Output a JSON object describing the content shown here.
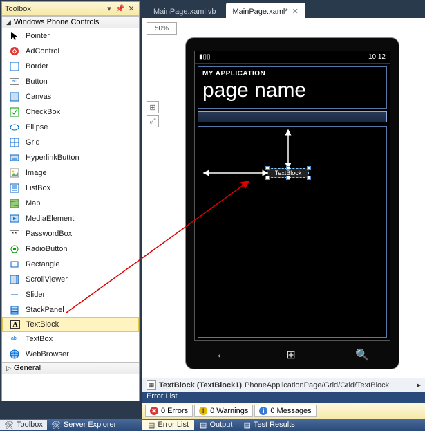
{
  "toolbox": {
    "title": "Toolbox",
    "groups": [
      {
        "label": "Windows Phone Controls",
        "expanded": true
      },
      {
        "label": "General",
        "expanded": false
      }
    ],
    "items": [
      {
        "label": "Pointer",
        "icon": "pointer-icon"
      },
      {
        "label": "AdControl",
        "icon": "adcontrol-icon"
      },
      {
        "label": "Border",
        "icon": "border-icon"
      },
      {
        "label": "Button",
        "icon": "button-icon"
      },
      {
        "label": "Canvas",
        "icon": "canvas-icon"
      },
      {
        "label": "CheckBox",
        "icon": "checkbox-icon"
      },
      {
        "label": "Ellipse",
        "icon": "ellipse-icon"
      },
      {
        "label": "Grid",
        "icon": "grid-icon"
      },
      {
        "label": "HyperlinkButton",
        "icon": "hyperlink-icon"
      },
      {
        "label": "Image",
        "icon": "image-icon"
      },
      {
        "label": "ListBox",
        "icon": "listbox-icon"
      },
      {
        "label": "Map",
        "icon": "map-icon"
      },
      {
        "label": "MediaElement",
        "icon": "media-icon"
      },
      {
        "label": "PasswordBox",
        "icon": "password-icon"
      },
      {
        "label": "RadioButton",
        "icon": "radio-icon"
      },
      {
        "label": "Rectangle",
        "icon": "rectangle-icon"
      },
      {
        "label": "ScrollViewer",
        "icon": "scrollviewer-icon"
      },
      {
        "label": "Slider",
        "icon": "slider-icon"
      },
      {
        "label": "StackPanel",
        "icon": "stackpanel-icon"
      },
      {
        "label": "TextBlock",
        "icon": "textblock-icon",
        "selected": true
      },
      {
        "label": "TextBox",
        "icon": "textbox-icon"
      },
      {
        "label": "WebBrowser",
        "icon": "webbrowser-icon"
      }
    ]
  },
  "tabs": [
    {
      "label": "MainPage.xaml.vb",
      "active": false
    },
    {
      "label": "MainPage.xaml*",
      "active": true
    }
  ],
  "designer": {
    "zoom": "50%",
    "status_time": "10:12",
    "app_label": "MY APPLICATION",
    "page_name": "page name",
    "selected_element_text": "TextBlock"
  },
  "breadcrumb": {
    "selected": "TextBlock (TextBlock1)",
    "path": "PhoneApplicationPage/Grid/Grid/TextBlock"
  },
  "error_list": {
    "title": "Error List",
    "errors": "0 Errors",
    "warnings": "0 Warnings",
    "messages": "0 Messages"
  },
  "status_tabs": [
    {
      "label": "Error List",
      "active": true
    },
    {
      "label": "Output",
      "active": false
    },
    {
      "label": "Test Results",
      "active": false
    }
  ],
  "bottom_left_tabs": [
    {
      "label": "Toolbox",
      "active": true
    },
    {
      "label": "Server Explorer",
      "active": false
    }
  ]
}
